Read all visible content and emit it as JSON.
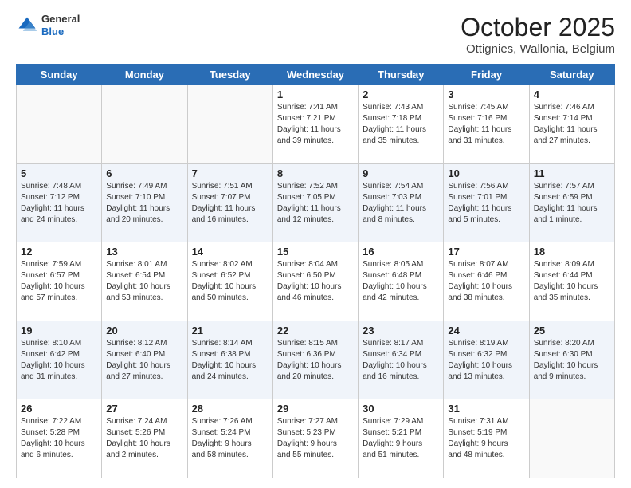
{
  "logo": {
    "general": "General",
    "blue": "Blue"
  },
  "title": "October 2025",
  "subtitle": "Ottignies, Wallonia, Belgium",
  "weekdays": [
    "Sunday",
    "Monday",
    "Tuesday",
    "Wednesday",
    "Thursday",
    "Friday",
    "Saturday"
  ],
  "weeks": [
    [
      {
        "day": "",
        "info": ""
      },
      {
        "day": "",
        "info": ""
      },
      {
        "day": "",
        "info": ""
      },
      {
        "day": "1",
        "info": "Sunrise: 7:41 AM\nSunset: 7:21 PM\nDaylight: 11 hours\nand 39 minutes."
      },
      {
        "day": "2",
        "info": "Sunrise: 7:43 AM\nSunset: 7:18 PM\nDaylight: 11 hours\nand 35 minutes."
      },
      {
        "day": "3",
        "info": "Sunrise: 7:45 AM\nSunset: 7:16 PM\nDaylight: 11 hours\nand 31 minutes."
      },
      {
        "day": "4",
        "info": "Sunrise: 7:46 AM\nSunset: 7:14 PM\nDaylight: 11 hours\nand 27 minutes."
      }
    ],
    [
      {
        "day": "5",
        "info": "Sunrise: 7:48 AM\nSunset: 7:12 PM\nDaylight: 11 hours\nand 24 minutes."
      },
      {
        "day": "6",
        "info": "Sunrise: 7:49 AM\nSunset: 7:10 PM\nDaylight: 11 hours\nand 20 minutes."
      },
      {
        "day": "7",
        "info": "Sunrise: 7:51 AM\nSunset: 7:07 PM\nDaylight: 11 hours\nand 16 minutes."
      },
      {
        "day": "8",
        "info": "Sunrise: 7:52 AM\nSunset: 7:05 PM\nDaylight: 11 hours\nand 12 minutes."
      },
      {
        "day": "9",
        "info": "Sunrise: 7:54 AM\nSunset: 7:03 PM\nDaylight: 11 hours\nand 8 minutes."
      },
      {
        "day": "10",
        "info": "Sunrise: 7:56 AM\nSunset: 7:01 PM\nDaylight: 11 hours\nand 5 minutes."
      },
      {
        "day": "11",
        "info": "Sunrise: 7:57 AM\nSunset: 6:59 PM\nDaylight: 11 hours\nand 1 minute."
      }
    ],
    [
      {
        "day": "12",
        "info": "Sunrise: 7:59 AM\nSunset: 6:57 PM\nDaylight: 10 hours\nand 57 minutes."
      },
      {
        "day": "13",
        "info": "Sunrise: 8:01 AM\nSunset: 6:54 PM\nDaylight: 10 hours\nand 53 minutes."
      },
      {
        "day": "14",
        "info": "Sunrise: 8:02 AM\nSunset: 6:52 PM\nDaylight: 10 hours\nand 50 minutes."
      },
      {
        "day": "15",
        "info": "Sunrise: 8:04 AM\nSunset: 6:50 PM\nDaylight: 10 hours\nand 46 minutes."
      },
      {
        "day": "16",
        "info": "Sunrise: 8:05 AM\nSunset: 6:48 PM\nDaylight: 10 hours\nand 42 minutes."
      },
      {
        "day": "17",
        "info": "Sunrise: 8:07 AM\nSunset: 6:46 PM\nDaylight: 10 hours\nand 38 minutes."
      },
      {
        "day": "18",
        "info": "Sunrise: 8:09 AM\nSunset: 6:44 PM\nDaylight: 10 hours\nand 35 minutes."
      }
    ],
    [
      {
        "day": "19",
        "info": "Sunrise: 8:10 AM\nSunset: 6:42 PM\nDaylight: 10 hours\nand 31 minutes."
      },
      {
        "day": "20",
        "info": "Sunrise: 8:12 AM\nSunset: 6:40 PM\nDaylight: 10 hours\nand 27 minutes."
      },
      {
        "day": "21",
        "info": "Sunrise: 8:14 AM\nSunset: 6:38 PM\nDaylight: 10 hours\nand 24 minutes."
      },
      {
        "day": "22",
        "info": "Sunrise: 8:15 AM\nSunset: 6:36 PM\nDaylight: 10 hours\nand 20 minutes."
      },
      {
        "day": "23",
        "info": "Sunrise: 8:17 AM\nSunset: 6:34 PM\nDaylight: 10 hours\nand 16 minutes."
      },
      {
        "day": "24",
        "info": "Sunrise: 8:19 AM\nSunset: 6:32 PM\nDaylight: 10 hours\nand 13 minutes."
      },
      {
        "day": "25",
        "info": "Sunrise: 8:20 AM\nSunset: 6:30 PM\nDaylight: 10 hours\nand 9 minutes."
      }
    ],
    [
      {
        "day": "26",
        "info": "Sunrise: 7:22 AM\nSunset: 5:28 PM\nDaylight: 10 hours\nand 6 minutes."
      },
      {
        "day": "27",
        "info": "Sunrise: 7:24 AM\nSunset: 5:26 PM\nDaylight: 10 hours\nand 2 minutes."
      },
      {
        "day": "28",
        "info": "Sunrise: 7:26 AM\nSunset: 5:24 PM\nDaylight: 9 hours\nand 58 minutes."
      },
      {
        "day": "29",
        "info": "Sunrise: 7:27 AM\nSunset: 5:23 PM\nDaylight: 9 hours\nand 55 minutes."
      },
      {
        "day": "30",
        "info": "Sunrise: 7:29 AM\nSunset: 5:21 PM\nDaylight: 9 hours\nand 51 minutes."
      },
      {
        "day": "31",
        "info": "Sunrise: 7:31 AM\nSunset: 5:19 PM\nDaylight: 9 hours\nand 48 minutes."
      },
      {
        "day": "",
        "info": ""
      }
    ]
  ]
}
